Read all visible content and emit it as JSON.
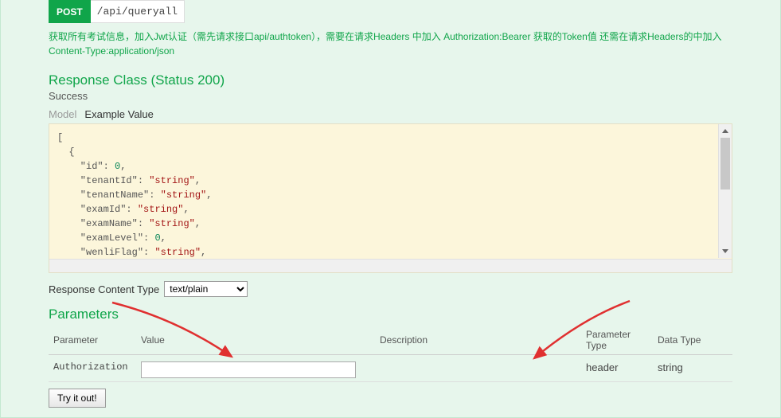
{
  "endpoint": {
    "method": "POST",
    "path": "/api/queryall",
    "description": "获取所有考试信息，加入Jwt认证（需先请求接口api/authtoken），需要在请求Headers 中加入 Authorization:Bearer 获取的Token值 还需在请求Headers的中加入 Content-Type:application/json"
  },
  "response": {
    "class_label": "Response Class (Status 200)",
    "status_text": "Success",
    "tabs": {
      "model": "Model",
      "example": "Example Value"
    },
    "example_json": "[\n  {\n    \"id\": 0,\n    \"tenantId\": \"string\",\n    \"tenantName\": \"string\",\n    \"examId\": \"string\",\n    \"examName\": \"string\",\n    \"examLevel\": 0,\n    \"wenliFlag\": \"string\","
  },
  "content_type": {
    "label": "Response Content Type",
    "options": [
      "text/plain"
    ],
    "selected": "text/plain"
  },
  "parameters": {
    "heading": "Parameters",
    "columns": {
      "name": "Parameter",
      "value": "Value",
      "desc": "Description",
      "ptype": "Parameter Type",
      "dtype": "Data Type"
    },
    "rows": [
      {
        "name": "Authorization",
        "value": "",
        "desc": "",
        "ptype": "header",
        "dtype": "string"
      }
    ]
  },
  "actions": {
    "try": "Try it out!"
  }
}
